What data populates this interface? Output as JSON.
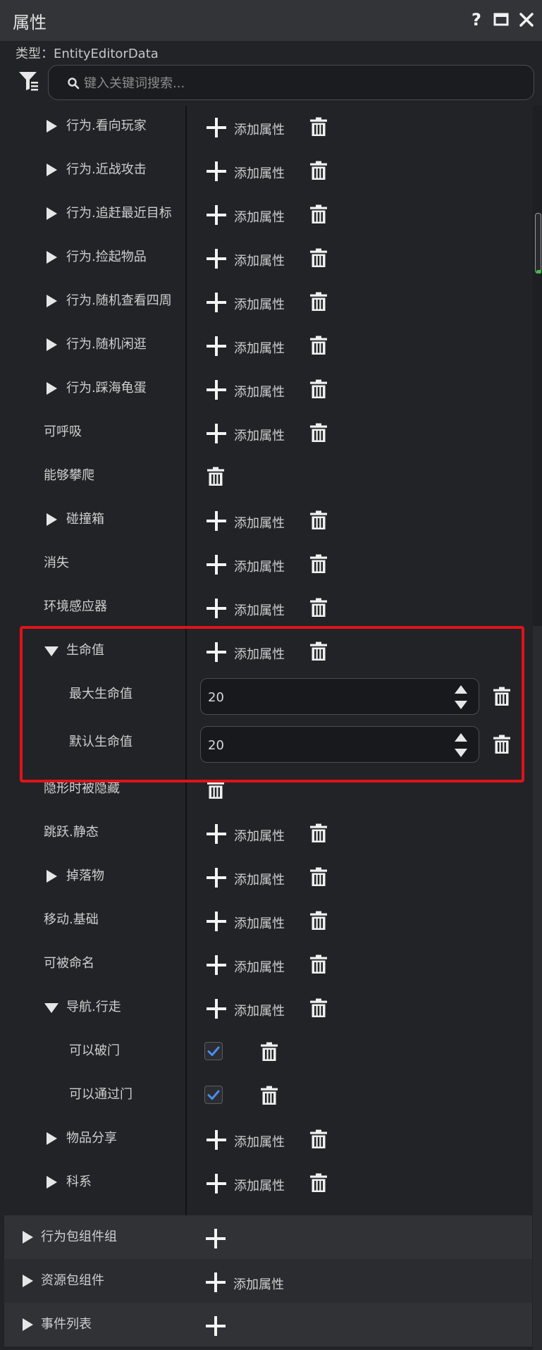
{
  "window": {
    "title": "属性",
    "help_icon": "question-mark-icon",
    "maximize_icon": "maximize-icon",
    "close_icon": "close-icon"
  },
  "type_line": "类型：EntityEditorData",
  "search": {
    "placeholder": "键入关键词搜索..."
  },
  "labels": {
    "add_property": "添加属性"
  },
  "rows": [
    {
      "label": "行为.看向玩家",
      "expander": "collapsed",
      "add": "label",
      "delete": true
    },
    {
      "label": "行为.近战攻击",
      "expander": "collapsed",
      "add": "label",
      "delete": true
    },
    {
      "label": "行为.追赶最近目标",
      "expander": "collapsed",
      "add": "label",
      "delete": true
    },
    {
      "label": "行为.捡起物品",
      "expander": "collapsed",
      "add": "label",
      "delete": true
    },
    {
      "label": "行为.随机查看四周",
      "expander": "collapsed",
      "add": "label",
      "delete": true
    },
    {
      "label": "行为.随机闲逛",
      "expander": "collapsed",
      "add": "label",
      "delete": true
    },
    {
      "label": "行为.踩海龟蛋",
      "expander": "collapsed",
      "add": "label",
      "delete": true
    },
    {
      "label": "可呼吸",
      "expander": "none",
      "add": "label",
      "delete": true
    },
    {
      "label": "能够攀爬",
      "expander": "none",
      "add": "none",
      "delete": true
    },
    {
      "label": "碰撞箱",
      "expander": "collapsed",
      "add": "label",
      "delete": true
    },
    {
      "label": "消失",
      "expander": "none",
      "add": "label",
      "delete": true
    },
    {
      "label": "环境感应器",
      "expander": "none",
      "add": "label",
      "delete": true
    },
    {
      "label": "生命值",
      "expander": "expanded",
      "add": "label",
      "delete": true
    },
    {
      "label": "最大生命值",
      "child": true,
      "value": "20",
      "delete": true
    },
    {
      "label": "默认生命值",
      "child": true,
      "value": "20",
      "delete": true
    },
    {
      "label": "隐形时被隐藏",
      "expander": "none",
      "add": "none",
      "delete": true
    },
    {
      "label": "跳跃.静态",
      "expander": "none",
      "add": "label",
      "delete": true
    },
    {
      "label": "掉落物",
      "expander": "collapsed",
      "add": "label",
      "delete": true
    },
    {
      "label": "移动.基础",
      "expander": "none",
      "add": "label",
      "delete": true
    },
    {
      "label": "可被命名",
      "expander": "none",
      "add": "label",
      "delete": true
    },
    {
      "label": "导航.行走",
      "expander": "expanded",
      "add": "label",
      "delete": true
    },
    {
      "label": "可以破门",
      "child": true,
      "checked": true,
      "delete": true
    },
    {
      "label": "可以通过门",
      "child": true,
      "checked": true,
      "delete": true
    },
    {
      "label": "物品分享",
      "expander": "collapsed",
      "add": "label",
      "delete": true
    },
    {
      "label": "科系",
      "expander": "collapsed",
      "add": "label",
      "delete": true
    }
  ],
  "sections": [
    {
      "label": "行为包组件组",
      "add": "icon"
    },
    {
      "label": "资源包组件",
      "add": "label"
    },
    {
      "label": "事件列表",
      "add": "icon"
    }
  ],
  "colors": {
    "background": "#222326",
    "titlebar": "#323437",
    "highlight_border": "#e0131a",
    "checkbox_check": "#4a8cf0",
    "scroll_indicator": "#3fbf3f"
  }
}
